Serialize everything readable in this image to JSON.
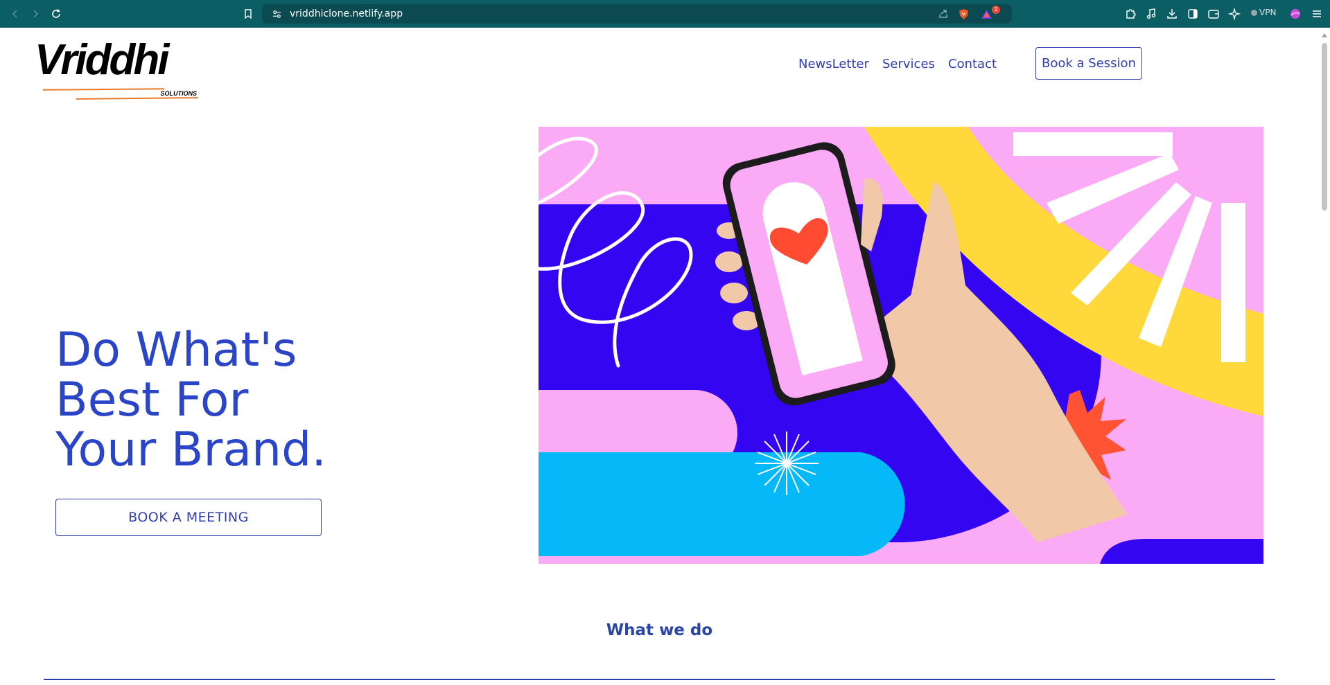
{
  "browser": {
    "url": "vriddhiclone.netlify.app",
    "vpn_label": "VPN",
    "notification_count": "1"
  },
  "header": {
    "logo_text": "Vriddhi",
    "logo_subtext": "SOLUTIONS",
    "nav_items": [
      "NewsLetter",
      "Services",
      "Contact"
    ],
    "cta_label": "Book a Session"
  },
  "hero": {
    "title_lines": [
      "Do What's",
      "Best For",
      "Your Brand."
    ],
    "button_label": "BOOK A MEETING"
  },
  "section": {
    "title": "What we do"
  },
  "colors": {
    "brand_blue": "#2a45c8",
    "chrome_teal": "#0b5e63",
    "accent_orange": "#e87a2a"
  }
}
